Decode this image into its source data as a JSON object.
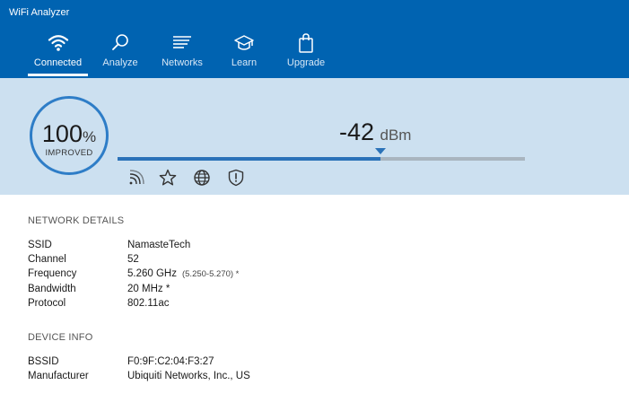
{
  "app": {
    "title": "WiFi Analyzer"
  },
  "nav": {
    "items": [
      {
        "label": "Connected",
        "icon": "wifi-icon",
        "active": true
      },
      {
        "label": "Analyze",
        "icon": "magnifier-icon",
        "active": false
      },
      {
        "label": "Networks",
        "icon": "networks-icon",
        "active": false
      },
      {
        "label": "Learn",
        "icon": "graduation-cap-icon",
        "active": false
      },
      {
        "label": "Upgrade",
        "icon": "shopping-bag-icon",
        "active": false
      }
    ]
  },
  "signal": {
    "quality_value": "100",
    "quality_unit": "%",
    "quality_status": "IMPROVED",
    "strength_value": "-42",
    "strength_unit": "dBm",
    "strength_fraction": 0.645,
    "actions": [
      {
        "icon": "signal-icon"
      },
      {
        "icon": "star-icon"
      },
      {
        "icon": "globe-icon"
      },
      {
        "icon": "shield-icon"
      }
    ]
  },
  "network_details": {
    "title": "NETWORK DETAILS",
    "rows": [
      {
        "label": "SSID",
        "value": "NamasteTech",
        "extra": ""
      },
      {
        "label": "Channel",
        "value": "52",
        "extra": ""
      },
      {
        "label": "Frequency",
        "value": "5.260 GHz",
        "extra": "(5.250-5.270) *"
      },
      {
        "label": "Bandwidth",
        "value": "20 MHz *",
        "extra": ""
      },
      {
        "label": "Protocol",
        "value": "802.11ac",
        "extra": ""
      }
    ]
  },
  "device_info": {
    "title": "DEVICE INFO",
    "rows": [
      {
        "label": "BSSID",
        "value": "F0:9F:C2:04:F3:27"
      },
      {
        "label": "Manufacturer",
        "value": "Ubiquiti Networks, Inc., US"
      }
    ]
  },
  "colors": {
    "header_bg": "#0063b1",
    "panel_bg": "#cce0f0",
    "accent": "#2b72b8",
    "ring": "#2e7dc7"
  }
}
